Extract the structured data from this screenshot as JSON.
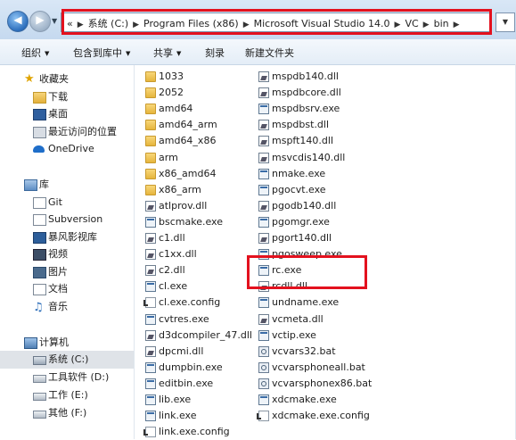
{
  "address": {
    "crumbs": [
      "«",
      "系统 (C:)",
      "Program Files (x86)",
      "Microsoft Visual Studio 14.0",
      "VC",
      "bin"
    ]
  },
  "toolbar": {
    "organize": "组织",
    "include_library": "包含到库中",
    "share": "共享",
    "burn": "刻录",
    "new_folder": "新建文件夹"
  },
  "nav": {
    "favorites": "收藏夹",
    "downloads": "下载",
    "desktop": "桌面",
    "recent": "最近访问的位置",
    "onedrive": "OneDrive",
    "libraries": "库",
    "git": "Git",
    "subversion": "Subversion",
    "baofeng": "暴风影视库",
    "videos": "视频",
    "pictures": "图片",
    "documents": "文档",
    "music": "音乐",
    "computer": "计算机",
    "drive_c": "系统 (C:)",
    "drive_d": "工具软件 (D:)",
    "drive_e": "工作 (E:)",
    "drive_f": "其他 (F:)"
  },
  "files": {
    "col1": [
      {
        "name": "1033",
        "type": "folder"
      },
      {
        "name": "2052",
        "type": "folder"
      },
      {
        "name": "amd64",
        "type": "folder"
      },
      {
        "name": "amd64_arm",
        "type": "folder"
      },
      {
        "name": "amd64_x86",
        "type": "folder"
      },
      {
        "name": "arm",
        "type": "folder"
      },
      {
        "name": "x86_amd64",
        "type": "folder"
      },
      {
        "name": "x86_arm",
        "type": "folder"
      },
      {
        "name": "atlprov.dll",
        "type": "dll"
      },
      {
        "name": "bscmake.exe",
        "type": "exe"
      },
      {
        "name": "c1.dll",
        "type": "dll"
      },
      {
        "name": "c1xx.dll",
        "type": "dll"
      },
      {
        "name": "c2.dll",
        "type": "dll"
      },
      {
        "name": "cl.exe",
        "type": "exe"
      },
      {
        "name": "cl.exe.config",
        "type": "cfg"
      },
      {
        "name": "cvtres.exe",
        "type": "exe"
      },
      {
        "name": "d3dcompiler_47.dll",
        "type": "dll"
      },
      {
        "name": "dpcmi.dll",
        "type": "dll"
      },
      {
        "name": "dumpbin.exe",
        "type": "exe"
      },
      {
        "name": "editbin.exe",
        "type": "exe"
      },
      {
        "name": "lib.exe",
        "type": "exe"
      },
      {
        "name": "link.exe",
        "type": "exe"
      },
      {
        "name": "link.exe.config",
        "type": "cfg"
      }
    ],
    "col2": [
      {
        "name": "mspdb140.dll",
        "type": "dll"
      },
      {
        "name": "mspdbcore.dll",
        "type": "dll"
      },
      {
        "name": "mspdbsrv.exe",
        "type": "exe"
      },
      {
        "name": "mspdbst.dll",
        "type": "dll"
      },
      {
        "name": "mspft140.dll",
        "type": "dll"
      },
      {
        "name": "msvcdis140.dll",
        "type": "dll"
      },
      {
        "name": "nmake.exe",
        "type": "exe"
      },
      {
        "name": "pgocvt.exe",
        "type": "exe"
      },
      {
        "name": "pgodb140.dll",
        "type": "dll"
      },
      {
        "name": "pgomgr.exe",
        "type": "exe"
      },
      {
        "name": "pgort140.dll",
        "type": "dll"
      },
      {
        "name": "pgosweep.exe",
        "type": "exe"
      },
      {
        "name": "rc.exe",
        "type": "exe"
      },
      {
        "name": "rcdll.dll",
        "type": "dll"
      },
      {
        "name": "undname.exe",
        "type": "exe"
      },
      {
        "name": "vcmeta.dll",
        "type": "dll"
      },
      {
        "name": "vctip.exe",
        "type": "exe"
      },
      {
        "name": "vcvars32.bat",
        "type": "bat"
      },
      {
        "name": "vcvarsphoneall.bat",
        "type": "bat"
      },
      {
        "name": "vcvarsphonex86.bat",
        "type": "bat"
      },
      {
        "name": "xdcmake.exe",
        "type": "exe"
      },
      {
        "name": "xdcmake.exe.config",
        "type": "cfg"
      }
    ]
  },
  "colors": {
    "highlight": "#e3111e",
    "selection": "#dfe3e8"
  }
}
